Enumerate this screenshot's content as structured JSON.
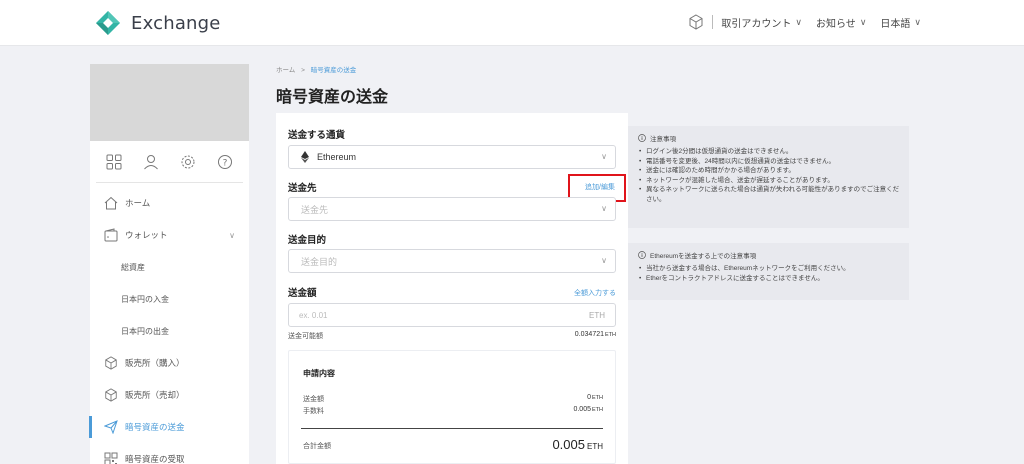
{
  "header": {
    "app_name": "Exchange",
    "menus": [
      {
        "label": "取引アカウント"
      },
      {
        "label": "お知らせ"
      },
      {
        "label": "日本語"
      }
    ],
    "accent": "#4b9bd8"
  },
  "sidebar": {
    "tabs": [
      "grid-icon",
      "user-icon",
      "gear-icon",
      "help-icon"
    ],
    "items": [
      {
        "label": "ホーム",
        "icon": "home-icon"
      },
      {
        "label": "ウォレット",
        "icon": "wallet-icon"
      },
      {
        "label": "総資産"
      },
      {
        "label": "日本円の入金"
      },
      {
        "label": "日本円の出金"
      },
      {
        "label": "販売所（購入）",
        "icon": "cube-icon"
      },
      {
        "label": "販売所（売却）",
        "icon": "cube-icon"
      },
      {
        "label": "暗号資産の送金",
        "icon": "send-icon",
        "active": true
      },
      {
        "label": "暗号資産の受取",
        "icon": "qr-icon"
      }
    ]
  },
  "breadcrumb": {
    "home": "ホーム",
    "arrow": ">",
    "current": "暗号資産の送金"
  },
  "page_title": "暗号資産の送金",
  "form": {
    "currency_label": "送金する通貨",
    "currency_value": "Ethereum",
    "destination_label": "送金先",
    "destination_link": "追加/編集",
    "destination_placeholder": "送金先",
    "purpose_label": "送金目的",
    "purpose_placeholder": "送金目的",
    "amount_label": "送金額",
    "amount_link": "全額入力する",
    "amount_placeholder": "ex. 0.01",
    "amount_unit": "ETH",
    "available_label": "送金可能額",
    "available_value": "0.034721",
    "available_unit": "ETH"
  },
  "summary": {
    "title": "申請内容",
    "send_label": "送金額",
    "send_value": "0",
    "send_unit": "ETH",
    "fee_label": "手数料",
    "fee_value": "0.005",
    "fee_unit": "ETH",
    "total_label": "合計金額",
    "total_value": "0.005",
    "total_unit": "ETH"
  },
  "notes": {
    "title": "注意事項",
    "items": [
      "ログイン後2分間は仮想通貨の送金はできません。",
      "電話番号を変更後、24時間以内に仮想通貨の送金はできません。",
      "送金には確認のため時間がかかる場合があります。",
      "ネットワークが混雑した場合、送金が遅延することがあります。",
      "異なるネットワークに送られた場合は通貨が失われる可能性がありますのでご注意ください。"
    ]
  },
  "eth_notes": {
    "title": "Ethereumを送金する上での注意事項",
    "items": [
      "当社から送金する場合は、Ethereumネットワークをご利用ください。",
      "Etherをコントラクトアドレスに送金することはできません。"
    ]
  }
}
